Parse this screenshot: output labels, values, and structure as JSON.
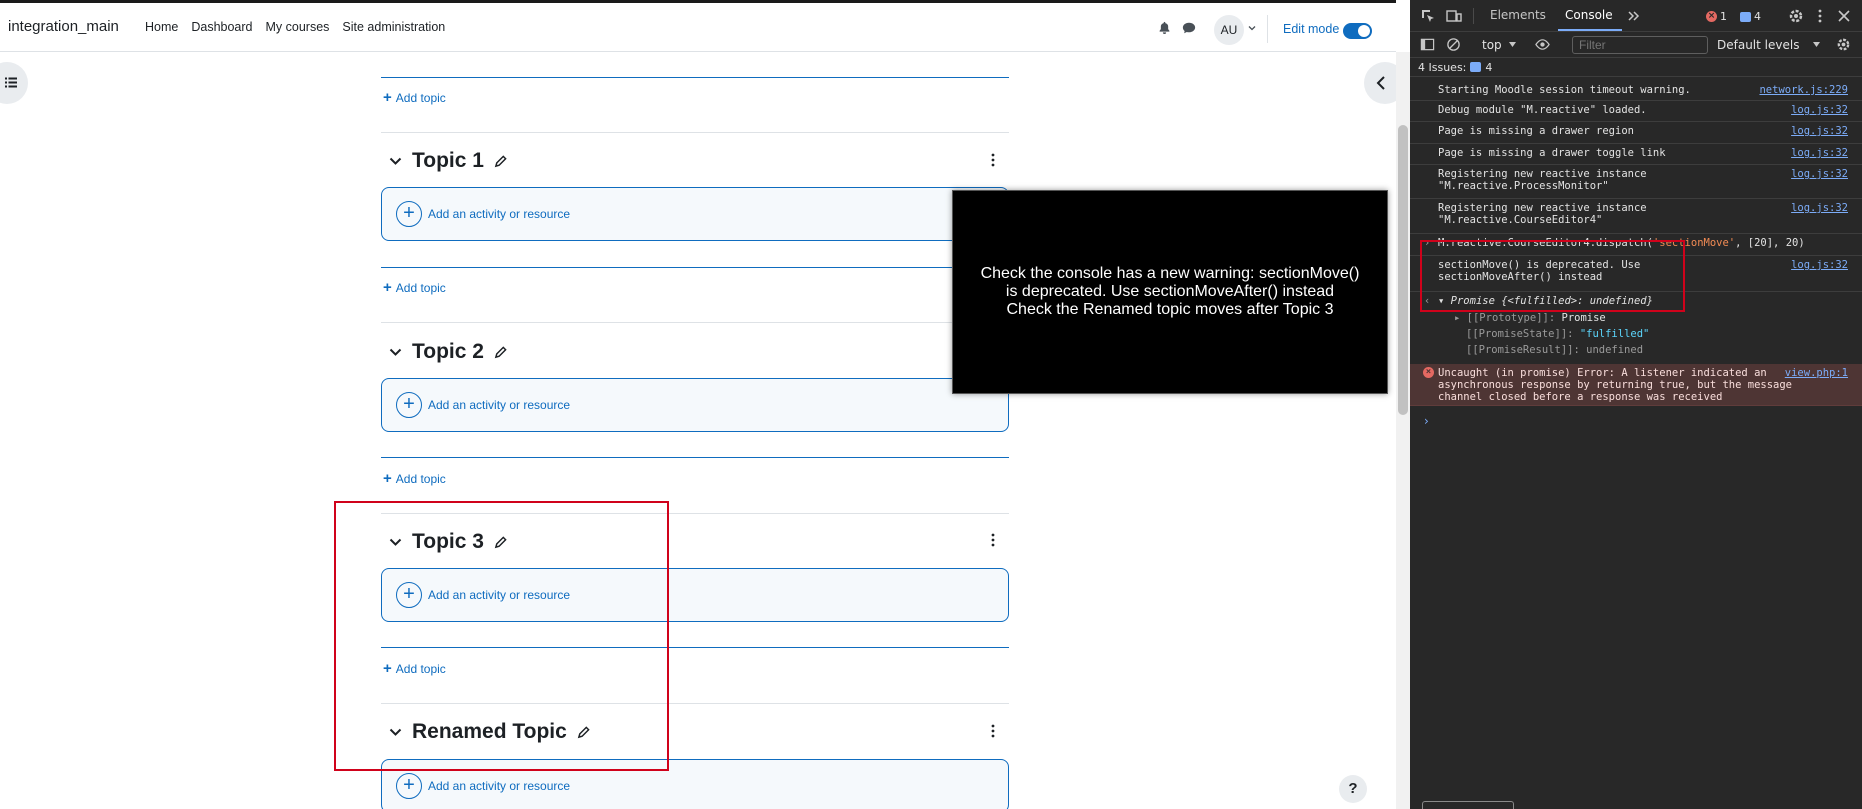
{
  "header": {
    "site_name": "integration_main",
    "nav": [
      "Home",
      "Dashboard",
      "My courses",
      "Site administration"
    ],
    "avatar_initials": "AU",
    "edit_mode_label": "Edit mode"
  },
  "course": {
    "add_topic_label": "Add topic",
    "add_activity_label": "Add an activity or resource",
    "sections": [
      "Topic 1",
      "Topic 2",
      "Topic 3",
      "Renamed Topic"
    ]
  },
  "popup": {
    "line1": "Check the console has a new warning: sectionMove() is deprecated. Use sectionMoveAfter() instead",
    "line2": "Check the Renamed topic moves after Topic 3"
  },
  "help_label": "?",
  "devtools": {
    "tabs": [
      "Elements",
      "Console"
    ],
    "error_count": "1",
    "issue_count": "4",
    "context": "top",
    "filter_placeholder": "Filter",
    "levels": "Default levels",
    "issues_label": "4 Issues:",
    "issues_count": "4",
    "logs": [
      {
        "text": "Starting Moodle session timeout warning.",
        "source": "network.js:229"
      },
      {
        "text": "Debug module \"M.reactive\" loaded.",
        "source": "log.js:32"
      },
      {
        "text": "Page is missing a drawer region",
        "source": "log.js:32"
      },
      {
        "text": "Page is missing a drawer toggle link",
        "source": "log.js:32"
      },
      {
        "text": "Registering new reactive instance \"M.reactive.ProcessMonitor\"",
        "source": "log.js:32"
      },
      {
        "text": "Registering new reactive instance \"M.reactive.CourseEditor4\"",
        "source": "log.js:32"
      }
    ],
    "command": {
      "prefix": "M.reactive.CourseEditor4.dispatch(",
      "arg_str": "'sectionMove'",
      "rest": ", [20], 20)"
    },
    "warning": {
      "text": "sectionMove() is deprecated. Use sectionMoveAfter() instead",
      "source": "log.js:32"
    },
    "result": {
      "summary": "Promise {<fulfilled>: undefined}",
      "prototype_key": "[[Prototype]]",
      "prototype_val": "Promise",
      "state_key": "[[PromiseState]]",
      "state_val": "\"fulfilled\"",
      "result_key": "[[PromiseResult]]",
      "result_val": "undefined"
    },
    "error": {
      "text": "Uncaught (in promise) Error: A listener indicated an asynchronous response by returning true, but the message channel closed before a response was received",
      "source": "view.php:1"
    }
  }
}
